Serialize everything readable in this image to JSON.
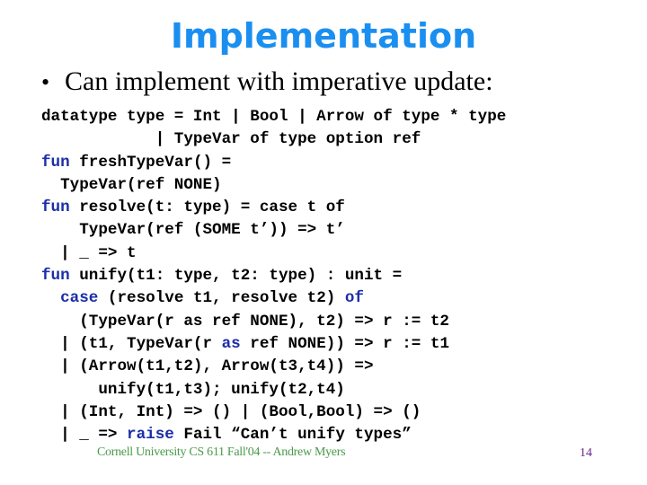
{
  "slide": {
    "title": "Implementation",
    "bullet": "Can implement with imperative update:",
    "bullet_glyph": "•",
    "keyword_color": "#1c2ea8",
    "title_color": "#1a8ff0",
    "code_lines": [
      [
        {
          "t": "datatype type = Int | Bool | Arrow of type * type",
          "kw": false
        }
      ],
      [
        {
          "t": "            | TypeVar of type option ref",
          "kw": false
        }
      ],
      [
        {
          "t": "fun",
          "kw": true
        },
        {
          "t": " freshTypeVar() =",
          "kw": false
        }
      ],
      [
        {
          "t": "  TypeVar(ref NONE)",
          "kw": false
        }
      ],
      [
        {
          "t": "fun",
          "kw": true
        },
        {
          "t": " resolve(t: type) = case t of",
          "kw": false
        }
      ],
      [
        {
          "t": "    TypeVar(ref (SOME t’)) => t’",
          "kw": false
        }
      ],
      [
        {
          "t": "  | _ => t",
          "kw": false
        }
      ],
      [
        {
          "t": "fun",
          "kw": true
        },
        {
          "t": " unify(t1: type, t2: type) : unit =",
          "kw": false
        }
      ],
      [
        {
          "t": "  ",
          "kw": false
        },
        {
          "t": "case",
          "kw": true
        },
        {
          "t": " (resolve t1, resolve t2) ",
          "kw": false
        },
        {
          "t": "of",
          "kw": true
        }
      ],
      [
        {
          "t": "    (TypeVar(r as ref NONE), t2) => r := t2",
          "kw": false
        }
      ],
      [
        {
          "t": "  | (t1, TypeVar(r ",
          "kw": false
        },
        {
          "t": "as",
          "kw": true
        },
        {
          "t": " ref NONE)) => r := t1",
          "kw": false
        }
      ],
      [
        {
          "t": "  | (Arrow(t1,t2), Arrow(t3,t4)) =>",
          "kw": false
        }
      ],
      [
        {
          "t": "      unify(t1,t3); unify(t2,t4)",
          "kw": false
        }
      ],
      [
        {
          "t": "  | (Int, Int) => () | (Bool,Bool) => ()",
          "kw": false
        }
      ],
      [
        {
          "t": "  | _ => ",
          "kw": false
        },
        {
          "t": "raise",
          "kw": true
        },
        {
          "t": " Fail “Can’t unify types”",
          "kw": false
        }
      ]
    ],
    "footer": "Cornell University CS 611 Fall'04 -- Andrew Myers",
    "page_number": "14"
  }
}
